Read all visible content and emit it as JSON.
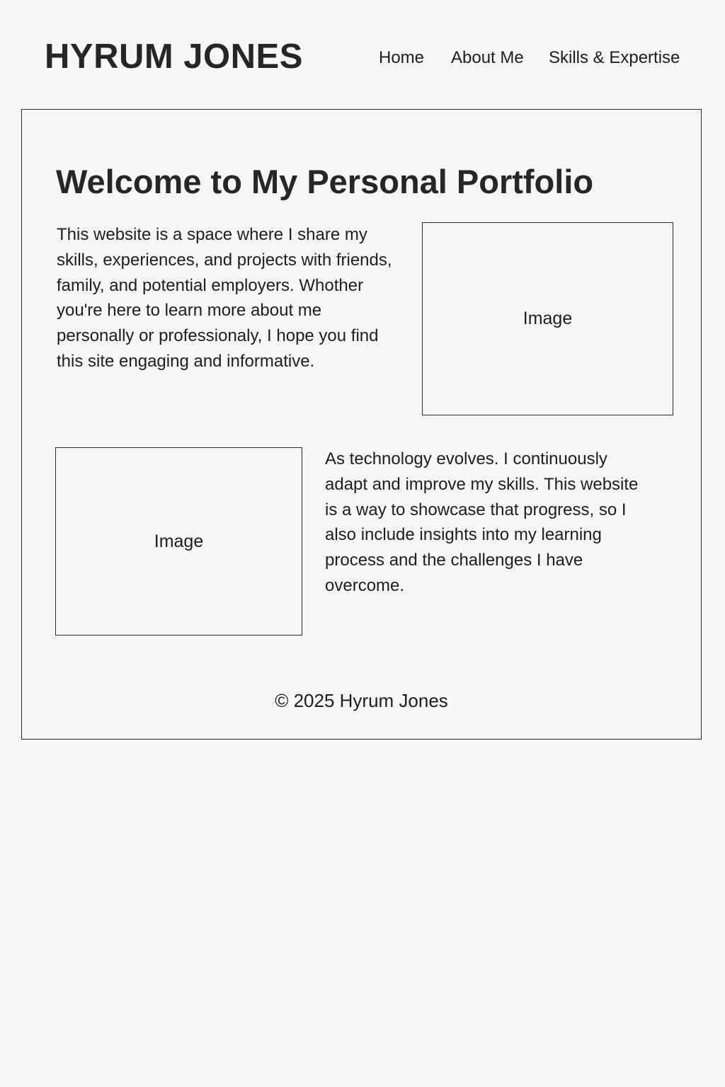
{
  "header": {
    "site_title": "HYRUM JONES",
    "nav": [
      {
        "label": "Home"
      },
      {
        "label": "About Me"
      },
      {
        "label": "Skills & Expertise"
      }
    ]
  },
  "main": {
    "heading": "Welcome to My Personal Portfolio",
    "intro_paragraph": "This website is a space where I share my skills, experiences, and projects with friends, family, and potential employers. Whother you're here to learn more about me personally or professionaly, I hope you find this site engaging and informative.",
    "image_placeholder_1": "Image",
    "image_placeholder_2": "Image",
    "growth_paragraph": "As technology evolves. I continuously adapt and improve my skills. This website is a way to showcase that progress, so I also include insights into my learning process and the challenges I have overcome."
  },
  "footer": {
    "copyright": "© 2025 Hyrum Jones"
  },
  "colors": {
    "background": "#f6f6f6",
    "text": "#1e1e1e",
    "border": "#2a2a2a"
  }
}
